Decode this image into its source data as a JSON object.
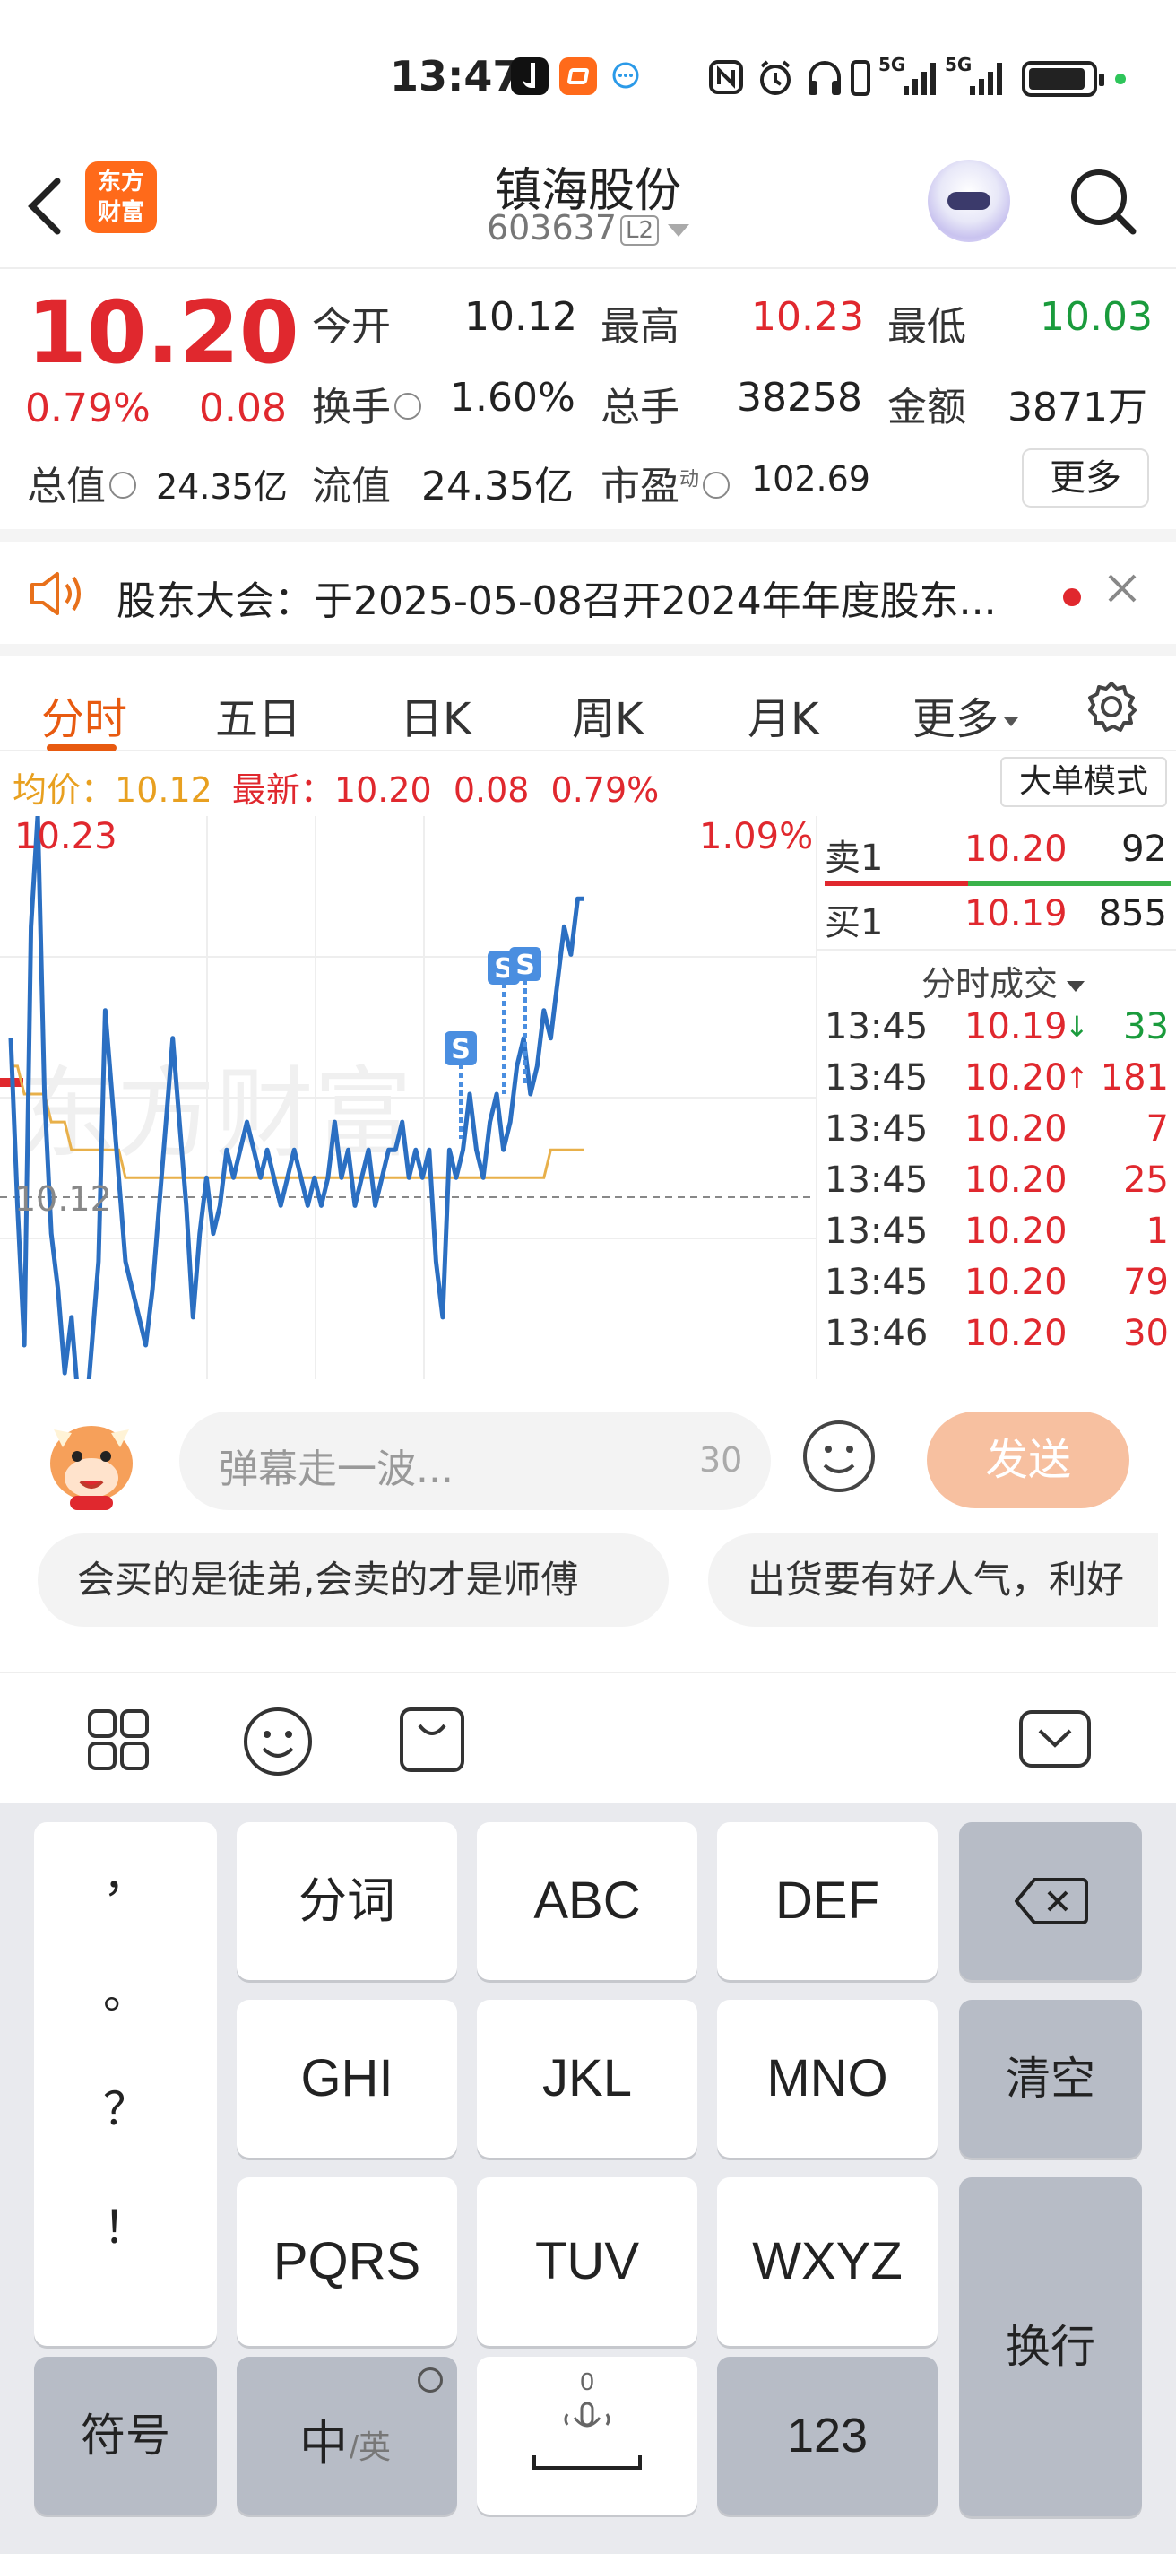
{
  "status_bar": {
    "time": "13:47",
    "signal_1": "5G",
    "signal_2": "5G"
  },
  "header": {
    "logo_text_line1": "东方",
    "logo_text_line2": "财富",
    "stock_name": "镇海股份",
    "stock_code": "603637",
    "level_badge": "L2"
  },
  "quote": {
    "price": "10.20",
    "change_pct": "0.79%",
    "change_amt": "0.08",
    "open_label": "今开",
    "open_value": "10.12",
    "high_label": "最高",
    "high_value": "10.23",
    "low_label": "最低",
    "low_value": "10.03",
    "turnover_label": "换手",
    "turnover_value": "1.60%",
    "volume_label": "总手",
    "volume_value": "38258",
    "amount_label": "金额",
    "amount_value": "3871万",
    "total_cap_label": "总值",
    "total_cap_value": "24.35亿",
    "float_cap_label": "流值",
    "float_cap_value": "24.35亿",
    "pe_label": "市盈",
    "pe_sup": "动",
    "pe_value": "102.69",
    "more_label": "更多"
  },
  "notice": {
    "text": "股东大会：于2025-05-08召开2024年年度股东..."
  },
  "tabs": [
    "分时",
    "五日",
    "日K",
    "周K",
    "月K",
    "更多"
  ],
  "chart_header": {
    "avg_label": "均价：",
    "avg_value": "10.12",
    "latest_label": "最新：",
    "latest_value": "10.20",
    "latest_change": "0.08",
    "latest_pct": "0.79%",
    "mode_button": "大单模式"
  },
  "chart_data": {
    "type": "line",
    "title": "",
    "y_top_label": "10.23",
    "y_mid_label": "10.12",
    "right_top_label": "1.09%",
    "ylim": [
      10.05,
      10.23
    ],
    "reference": 10.12,
    "series": [
      {
        "name": "",
        "color": "#2b6fc2",
        "values": [
          10.16,
          10.1,
          10.05,
          10.2,
          10.24,
          10.14,
          10.09,
          10.07,
          10.04,
          10.06,
          10.03,
          10.02,
          10.05,
          10.08,
          10.17,
          10.14,
          10.11,
          10.08,
          10.07,
          10.06,
          10.05,
          10.07,
          10.1,
          10.13,
          10.16,
          10.13,
          10.1,
          10.06,
          10.09,
          10.11,
          10.09,
          10.1,
          10.12,
          10.11,
          10.12,
          10.13,
          10.12,
          10.11,
          10.12,
          10.11,
          10.1,
          10.11,
          10.12,
          10.11,
          10.1,
          10.11,
          10.1,
          10.11,
          10.13,
          10.11,
          10.12,
          10.1,
          10.11,
          10.12,
          10.1,
          10.11,
          10.12,
          10.12,
          10.13,
          10.11,
          10.12,
          10.11,
          10.12,
          10.08,
          10.06,
          10.12,
          10.11,
          10.12,
          10.14,
          10.12,
          10.11,
          10.13,
          10.14,
          10.12,
          10.13,
          10.15,
          10.16,
          10.14,
          10.15,
          10.17,
          10.16,
          10.18,
          10.2,
          10.19,
          10.21,
          10.21
        ]
      },
      {
        "name": "",
        "color": "#e8b04a",
        "values": [
          10.15,
          10.15,
          10.14,
          10.14,
          10.14,
          10.14,
          10.13,
          10.13,
          10.13,
          10.12,
          10.12,
          10.12,
          10.12,
          10.12,
          10.12,
          10.12,
          10.12,
          10.11,
          10.11,
          10.11,
          10.11,
          10.11,
          10.11,
          10.11,
          10.11,
          10.11,
          10.11,
          10.11,
          10.11,
          10.11,
          10.11,
          10.11,
          10.11,
          10.11,
          10.11,
          10.11,
          10.11,
          10.11,
          10.11,
          10.11,
          10.11,
          10.11,
          10.11,
          10.11,
          10.11,
          10.11,
          10.11,
          10.11,
          10.11,
          10.11,
          10.11,
          10.11,
          10.11,
          10.11,
          10.11,
          10.11,
          10.11,
          10.11,
          10.11,
          10.11,
          10.11,
          10.11,
          10.11,
          10.11,
          10.11,
          10.11,
          10.11,
          10.11,
          10.11,
          10.11,
          10.11,
          10.11,
          10.11,
          10.11,
          10.11,
          10.11,
          10.11,
          10.11,
          10.11,
          10.11,
          10.12,
          10.12,
          10.12,
          10.12,
          10.12,
          10.12
        ]
      }
    ],
    "sell_markers": [
      "S",
      "S",
      "S"
    ]
  },
  "order_book": {
    "ask_label": "卖1",
    "ask_price": "10.20",
    "ask_volume": "92",
    "bid_label": "买1",
    "bid_price": "10.19",
    "bid_volume": "855",
    "trades_title": "分时成交",
    "trades": [
      {
        "time": "13:45",
        "price": "10.19",
        "arrow": "↓",
        "volume": "33"
      },
      {
        "time": "13:45",
        "price": "10.20",
        "arrow": "↑",
        "volume": "181"
      },
      {
        "time": "13:45",
        "price": "10.20",
        "arrow": "",
        "volume": "7"
      },
      {
        "time": "13:45",
        "price": "10.20",
        "arrow": "",
        "volume": "25"
      },
      {
        "time": "13:45",
        "price": "10.20",
        "arrow": "",
        "volume": "1"
      },
      {
        "time": "13:45",
        "price": "10.20",
        "arrow": "",
        "volume": "79"
      },
      {
        "time": "13:46",
        "price": "10.20",
        "arrow": "",
        "volume": "30"
      }
    ]
  },
  "danmu": {
    "placeholder": "弹幕走一波...",
    "char_count": "30",
    "send_label": "发送",
    "chips": [
      "会买的是徒弟,会卖的才是师傅",
      "出货要有好人气，利好"
    ]
  },
  "keyboard": {
    "punct": [
      "，",
      "。",
      "？",
      "！"
    ],
    "row1": [
      "分词",
      "ABC",
      "DEF"
    ],
    "row2": [
      "GHI",
      "JKL",
      "MNO"
    ],
    "row3": [
      "PQRS",
      "TUV",
      "WXYZ"
    ],
    "clear_label": "清空",
    "enter_label": "换行",
    "symbol_label": "符号",
    "lang_main": "中",
    "lang_sub": "/英",
    "space_hint": "0",
    "num_label": "123"
  }
}
